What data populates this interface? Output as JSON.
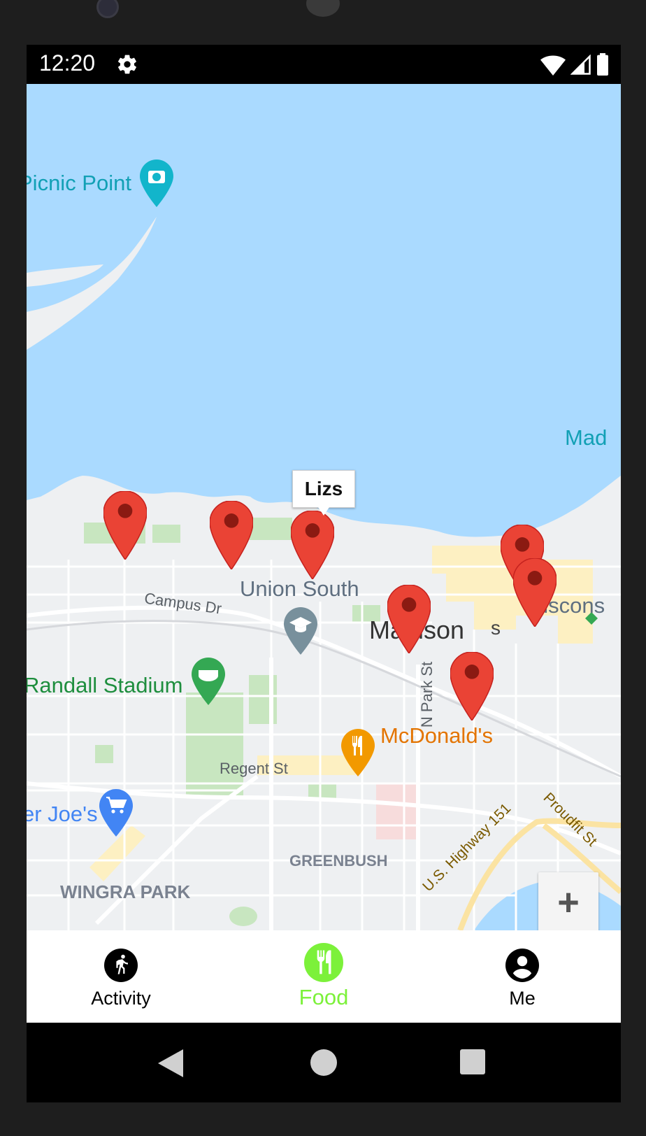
{
  "status_bar": {
    "time": "12:20"
  },
  "map": {
    "labels": {
      "picnic_point": "Picnic Point",
      "mad": "Mad",
      "union_south": "Union South",
      "campus_dr": "Campus Dr",
      "madison": "Madison",
      "madison_suffix": "s",
      "wisconsin": "Wiscons",
      "randall_stadium": "Randall Stadium",
      "n_park_st": "N Park St",
      "mcdonalds": "McDonald's",
      "regent_st": "Regent St",
      "joes": "er Joe's",
      "us_highway": "U.S. Highway 151",
      "proudfit": "Proudfit St",
      "greenbush": "GREENBUSH",
      "wingra_park": "WINGRA PARK"
    },
    "selected_marker_title": "Lizs",
    "zoom_in_label": "+",
    "colors": {
      "water": "#aadaff",
      "pin": "#ea4335",
      "pin_dot": "#8b1a12",
      "park": "#c8e6c0"
    }
  },
  "bottom_nav": {
    "items": [
      {
        "label": "Activity",
        "icon": "running-icon",
        "active": false
      },
      {
        "label": "Food",
        "icon": "restaurant-icon",
        "active": true
      },
      {
        "label": "Me",
        "icon": "account-circle-icon",
        "active": false
      }
    ],
    "active_color": "#7cf13a"
  },
  "system_nav": {
    "buttons": [
      "back",
      "home",
      "recents"
    ]
  }
}
